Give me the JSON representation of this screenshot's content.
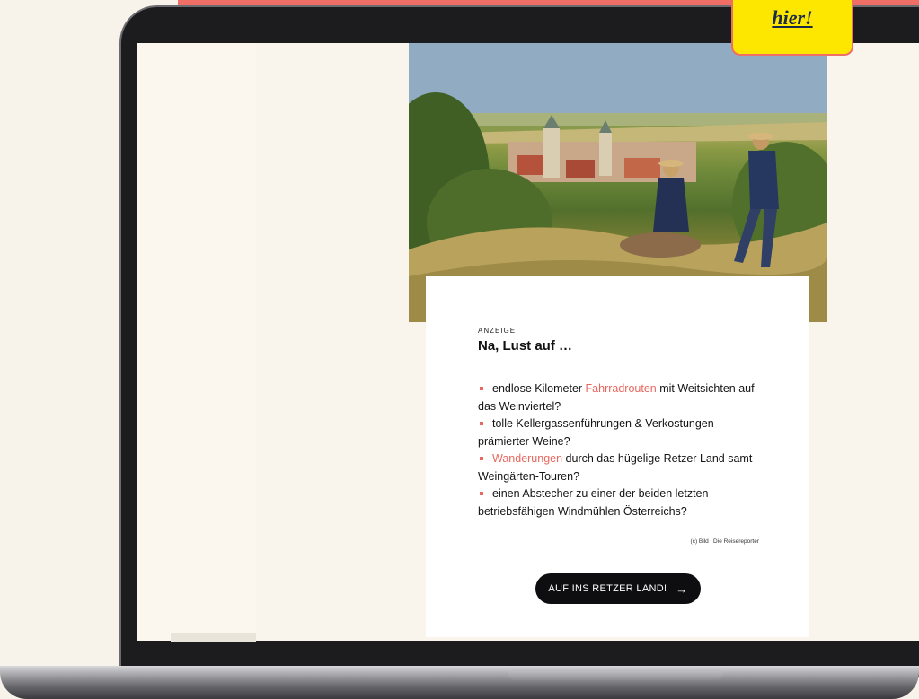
{
  "ad": {
    "label": "ANZEIGE",
    "title": "Na, Lust auf …",
    "bullets": [
      {
        "before": "endlose Kilometer ",
        "link": "Fahrradrouten",
        "after": " mit Weitsichten auf das Weinviertel?"
      },
      {
        "before": "tolle Kellergassenführungen & Verkostungen prämierter Weine?",
        "link": "",
        "after": ""
      },
      {
        "before": "",
        "link": "Wanderungen",
        "after": " durch das hügelige Retzer Land samt Weingärten-Touren?"
      },
      {
        "before": "einen Abstecher zu einer der beiden letzten betriebsfähigen Windmühlen Österreichs?",
        "link": "",
        "after": ""
      }
    ],
    "credit": "(c) Bild | Die Reisereporter",
    "cta_label": "AUF INS RETZER LAND!",
    "cta_arrow": "→"
  },
  "sticky": {
    "label": "hier!"
  },
  "colors": {
    "accent": "#e8685f",
    "banner": "#ef6f66",
    "sticky_bg": "#fde600",
    "button_bg": "#0e0e10",
    "page_bg": "#f8f3ea"
  }
}
